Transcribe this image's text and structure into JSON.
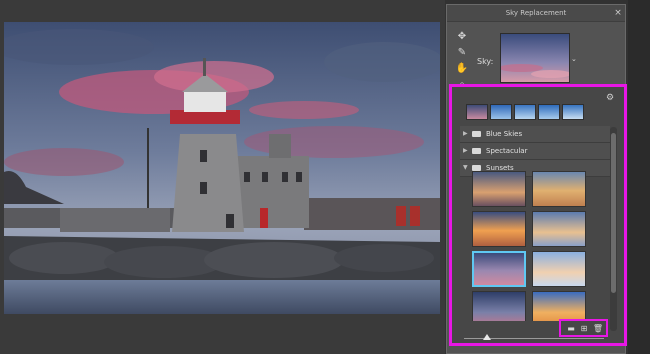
{
  "dialog": {
    "title": "Sky Replacement",
    "close_icon": "×",
    "tools": [
      "move-icon",
      "sky-brush-icon",
      "hand-icon",
      "zoom-icon"
    ],
    "sky_label": "Sky:"
  },
  "panel": {
    "folders": [
      {
        "label": "Blue Skies",
        "expanded": false
      },
      {
        "label": "Spectacular",
        "expanded": false
      },
      {
        "label": "Sunsets",
        "expanded": true
      }
    ],
    "bottom_icons": [
      "new-folder-icon",
      "add-sky-icon",
      "delete-icon"
    ]
  },
  "colors": {
    "highlight": "#e816e6",
    "selection": "#5fc8f2"
  }
}
